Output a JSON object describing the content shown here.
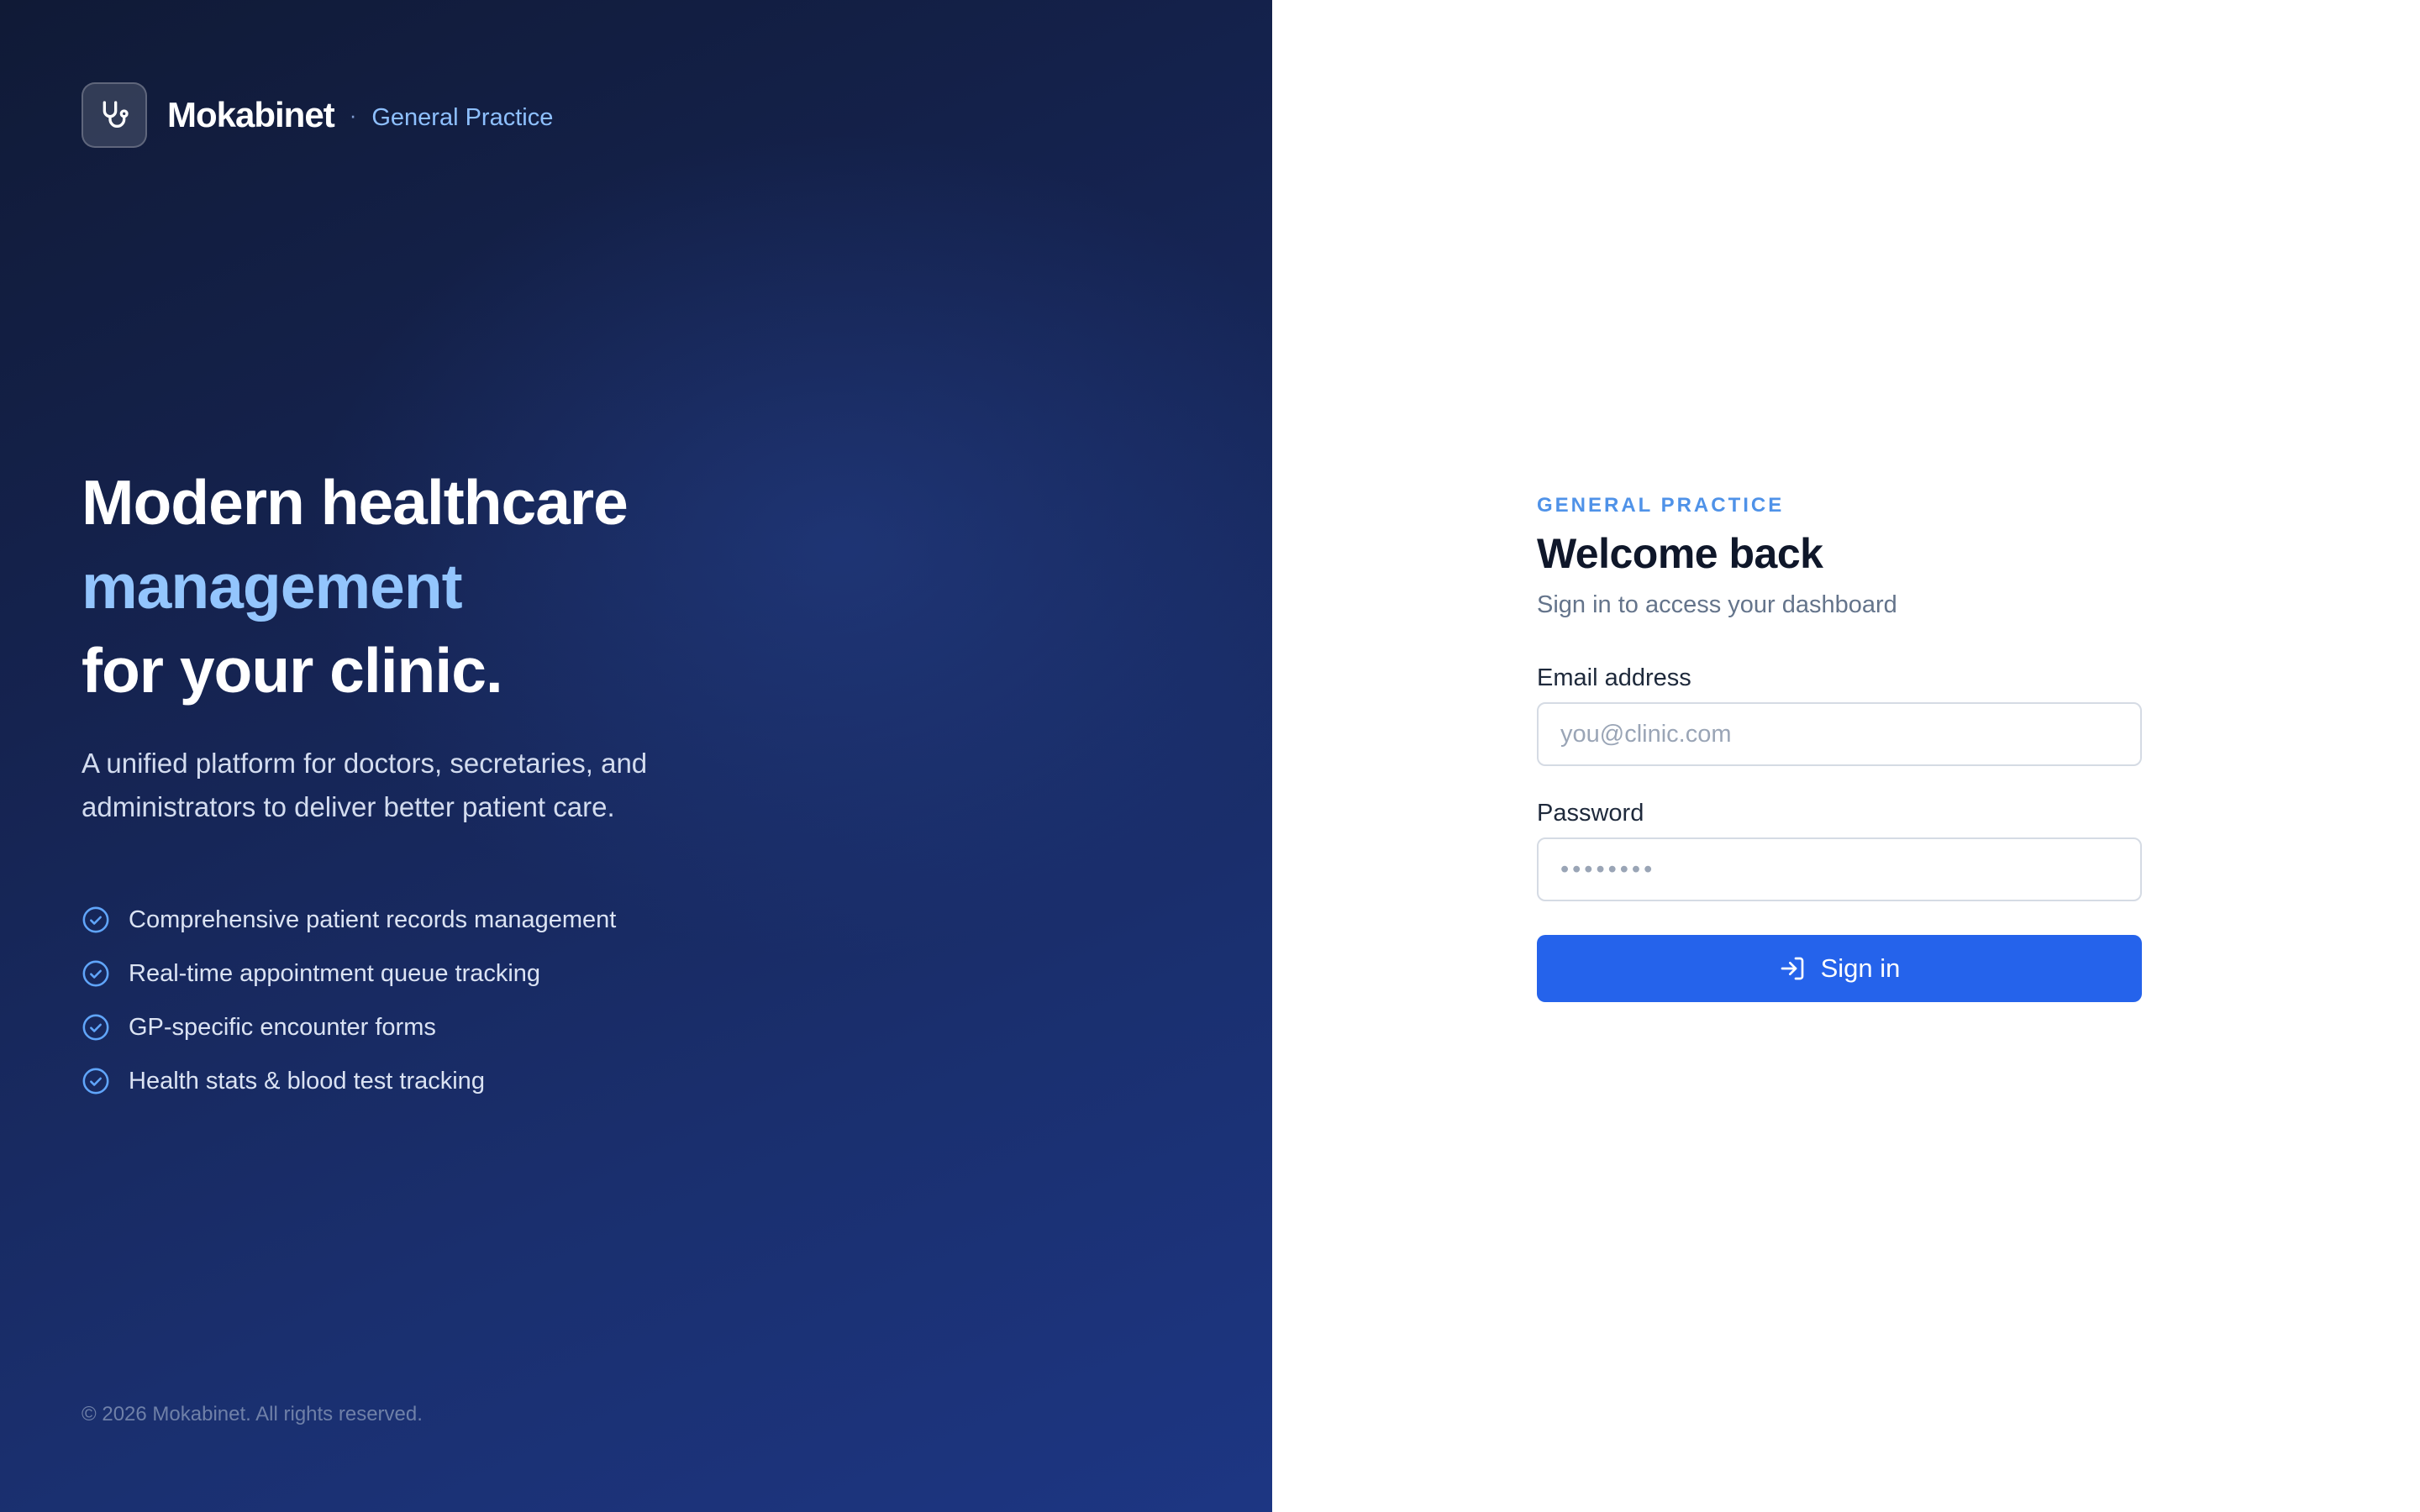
{
  "brand": {
    "name": "Mokabinet",
    "separator": "·",
    "subtitle": "General Practice",
    "logo_icon": "stethoscope-icon"
  },
  "hero": {
    "headline_line1": "Modern healthcare",
    "headline_line2": "management",
    "headline_line3": "for your clinic.",
    "description": "A unified platform for doctors, secretaries, and administrators to deliver better patient care.",
    "features": [
      {
        "label": "Comprehensive patient records management",
        "icon": "check-circle-icon"
      },
      {
        "label": "Real-time appointment queue tracking",
        "icon": "check-circle-icon"
      },
      {
        "label": "GP-specific encounter forms",
        "icon": "check-circle-icon"
      },
      {
        "label": "Health stats & blood test tracking",
        "icon": "check-circle-icon"
      }
    ],
    "copyright": "© 2026 Mokabinet. All rights reserved."
  },
  "login": {
    "eyebrow": "GENERAL PRACTICE",
    "title": "Welcome back",
    "subtitle": "Sign in to access your dashboard",
    "email_label": "Email address",
    "email_placeholder": "you@clinic.com",
    "email_value": "",
    "password_label": "Password",
    "password_placeholder": "••••••••",
    "password_value": "",
    "submit_label": "Sign in",
    "submit_icon": "sign-in-icon"
  },
  "colors": {
    "hero_bg_start": "#101a36",
    "hero_bg_end": "#1d3683",
    "accent_text": "#93c5fd",
    "brand_subtitle": "#8ec0ff",
    "eyebrow": "#4f92e8",
    "primary_button": "#2563eb",
    "title_text": "#0f172a"
  }
}
